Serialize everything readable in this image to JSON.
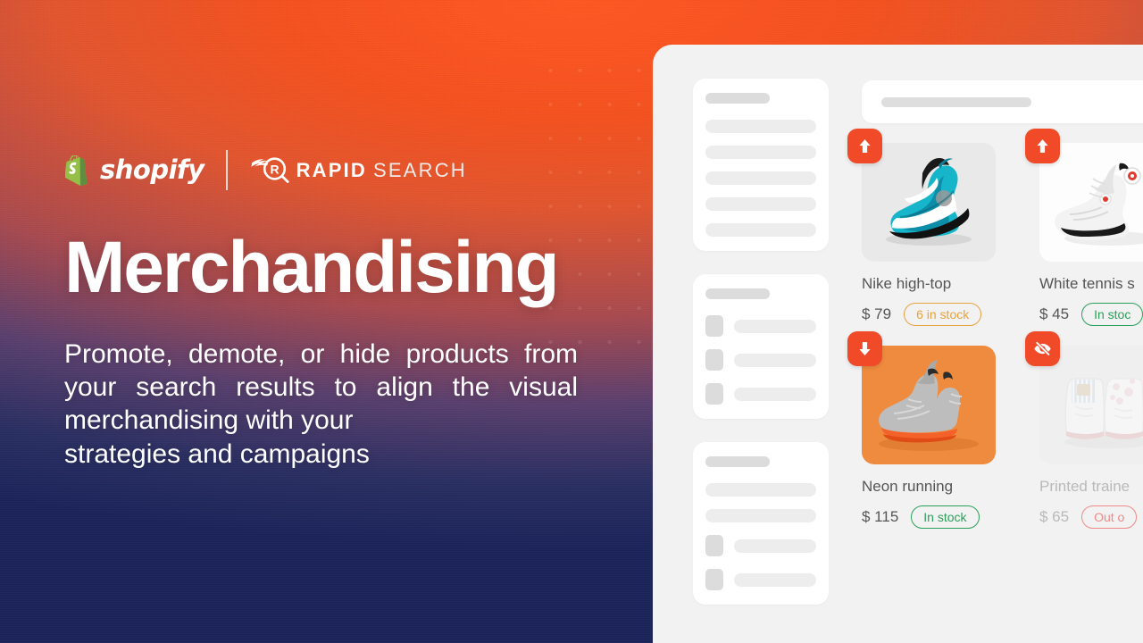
{
  "hero": {
    "logo": {
      "shopify_word": "shopify",
      "shopify_icon": "shopify-bag-icon",
      "rapid_strong": "RAPID",
      "rapid_light": "SEARCH",
      "rapid_icon": "magnifier-r-icon"
    },
    "headline": "Merchandising",
    "subheadline_main": "Promote, demote, or hide products from your search results to align the visual merchandising with your",
    "subheadline_last": "strategies and campaigns",
    "gradient_top": "#ff5722",
    "gradient_bottom": "#1b245a"
  },
  "app": {
    "panel_bg": "#f2f2f2",
    "search": {
      "placeholder": ""
    },
    "skeleton_panels": [
      {
        "header": true,
        "bars": 5,
        "rows": 0
      },
      {
        "header": true,
        "bars": 0,
        "rows": 3
      },
      {
        "header": true,
        "bars": 2,
        "rows": 2
      }
    ],
    "products": [
      {
        "title": "Nike high-top",
        "price": "$ 79",
        "stock_label": "6 in stock",
        "stock_state": "warn",
        "badge": "promote-up-arrow-icon",
        "badge_color": "#f04a28",
        "hidden": false
      },
      {
        "title": "White tennis s",
        "price": "$ 45",
        "stock_label": "In stoc",
        "stock_state": "ok",
        "badge": "promote-up-arrow-icon",
        "badge_color": "#f04a28",
        "hidden": false
      },
      {
        "title": "Neon running",
        "price": "$ 115",
        "stock_label": "In stock",
        "stock_state": "ok",
        "badge": "demote-down-arrow-icon",
        "badge_color": "#f04a28",
        "hidden": false
      },
      {
        "title": "Printed traine",
        "price": "$ 65",
        "stock_label": "Out o",
        "stock_state": "out",
        "badge": "hide-eye-slash-icon",
        "badge_color": "#f04a28",
        "hidden": true
      }
    ]
  }
}
